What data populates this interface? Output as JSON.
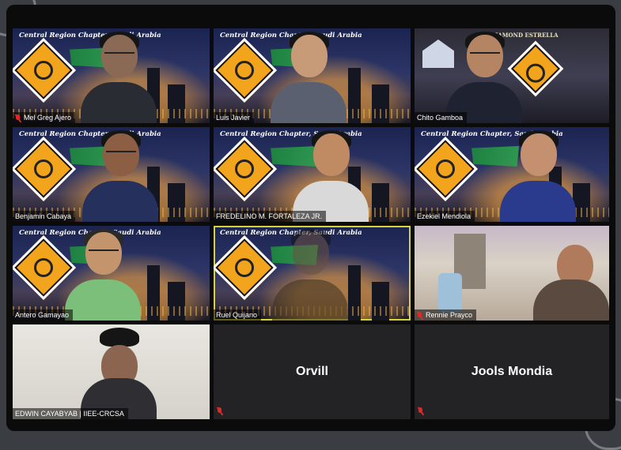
{
  "meeting": {
    "participants": [
      {
        "name": "Mel Greg Ajero",
        "muted": true,
        "banner": "Central Region Chapter, Saudi Arabia"
      },
      {
        "name": "Luis Javier",
        "muted": false,
        "banner": "Central Region Chapter, Saudi Arabia"
      },
      {
        "name": "Chito Gamboa",
        "muted": false,
        "banner": "DIAMOND ESTRELLA"
      },
      {
        "name": "Benjamin Cabaya",
        "muted": false,
        "banner": "Central Region Chapter, Saudi Arabia"
      },
      {
        "name": "FREDELINO M. FORTALEZA JR.",
        "muted": false,
        "banner": "Central Region Chapter, Saudi Arabia"
      },
      {
        "name": "Ezekiel Mendiola",
        "muted": false,
        "banner": "Central Region Chapter, Saudi Arabia"
      },
      {
        "name": "Antero Gamayao",
        "muted": false,
        "banner": "Central Region Chapter, Saudi Arabia"
      },
      {
        "name": "Ruel Quijano",
        "muted": false,
        "speaking": true,
        "banner": "Central Region Chapter, Saudi Arabia"
      },
      {
        "name": "Rennie Prayco",
        "muted": true,
        "banner": ""
      },
      {
        "name": "EDWIN CAYABYAB | IIEE-CRCSA",
        "muted": false,
        "banner": ""
      },
      {
        "name": "Orvill",
        "muted": true,
        "video_off": true
      },
      {
        "name": "Jools Mondia",
        "muted": true,
        "video_off": true
      }
    ]
  },
  "colors": {
    "speaking_border": "#d8d23a",
    "muted_icon": "#e02828",
    "tile_off": "#232325",
    "window_bg": "#0b0b0c"
  },
  "icons": [
    "mic-muted-icon",
    "logo-icon",
    "flag-icon"
  ]
}
